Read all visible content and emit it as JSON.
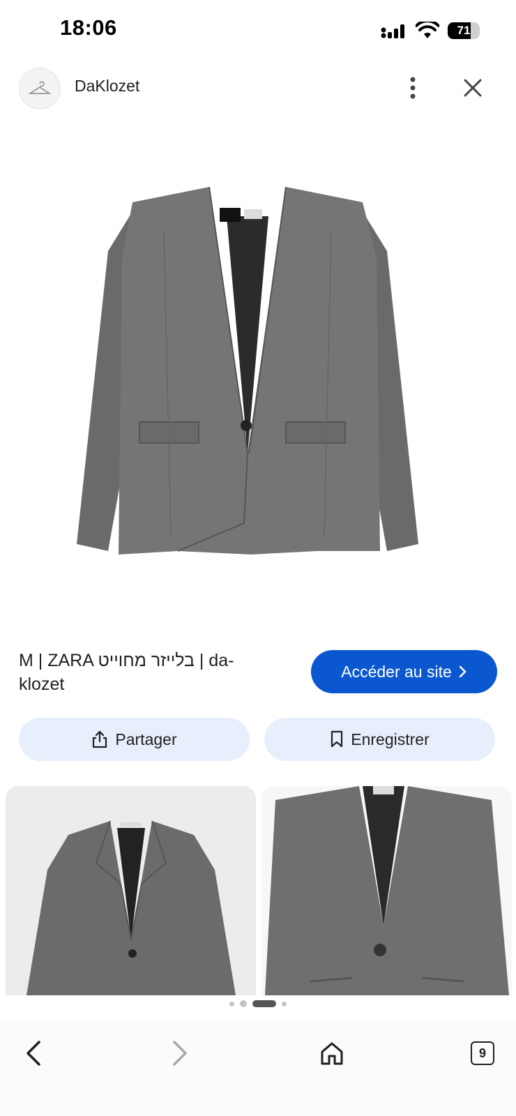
{
  "status_bar": {
    "time": "18:06",
    "battery": "71"
  },
  "header": {
    "site_name": "DaKlozet"
  },
  "product": {
    "title": "M | ZARA בלייזר מחוייט | da-klozet",
    "visit_label": "Accéder au site",
    "share_label": "Partager",
    "save_label": "Enregistrer"
  },
  "thumbnails": [
    {
      "name": "related-image-1"
    },
    {
      "name": "related-image-2"
    }
  ],
  "bottom_nav": {
    "tab_count": "9"
  },
  "colors": {
    "accent": "#0b57d0",
    "pill_bg": "#e8effc",
    "jacket": "#6e6e6e"
  }
}
